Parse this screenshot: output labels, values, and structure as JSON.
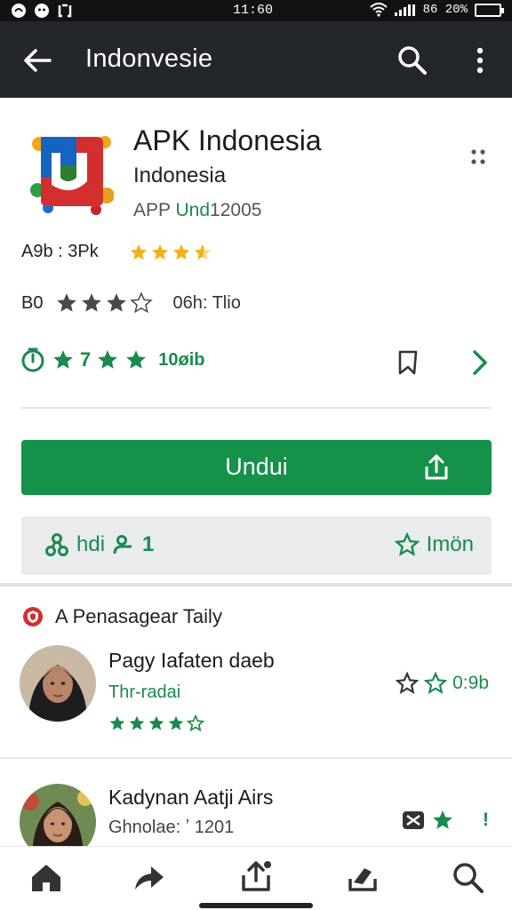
{
  "status_bar": {
    "time": "11:60",
    "battery": "86 20%"
  },
  "app_bar": {
    "title": "Indonvesie"
  },
  "app": {
    "name": "APK Indonesia",
    "developer": "Indonesia",
    "meta_prefix": "APP",
    "meta_accent": "Und",
    "meta_suffix": "12005",
    "rating_label": "A9b : 3Pk",
    "rating_stars": 3.5,
    "row2_label": "B0",
    "row2_stars": 3,
    "row2_sub": "06h: Tlio",
    "green_text": "★★★",
    "green_prefix": "7",
    "green_count": "10øib",
    "download_label": "Undui"
  },
  "stats": {
    "left_label": "hdi",
    "left_count": "1",
    "right_label": "Imön"
  },
  "section": {
    "title": "A Penasagear Taily"
  },
  "reviews": [
    {
      "name": "Pagy Iafaten daeb",
      "sub": "Thr-radai",
      "stars": 4,
      "side_value": "0:9b"
    },
    {
      "name": "Kadynan Aatji Airs",
      "meta": "Ghnolae: ʼ 1201",
      "side_mark": "!"
    }
  ],
  "colors": {
    "accent_green": "#16914a",
    "app_bar": "#23272b",
    "star_gold": "#f3b21a"
  }
}
